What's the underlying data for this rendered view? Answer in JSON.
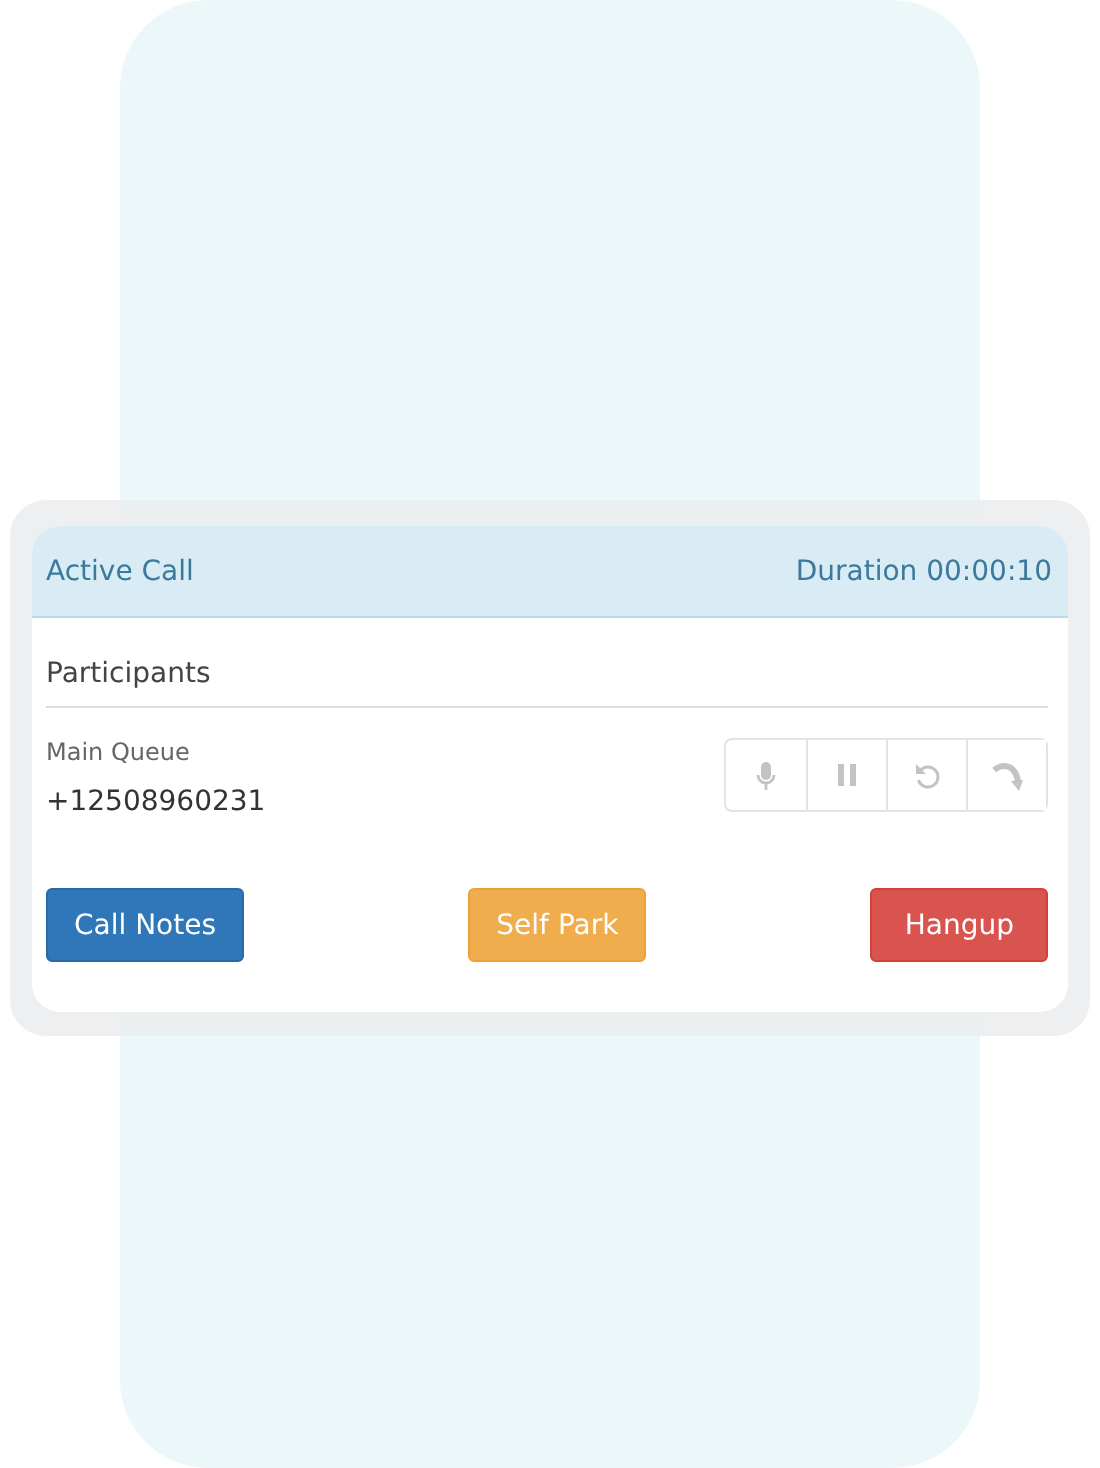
{
  "header": {
    "title": "Active Call",
    "duration": "Duration 00:00:10"
  },
  "participants": {
    "heading": "Participants",
    "items": [
      {
        "name": "Main Queue",
        "number": "+12508960231"
      }
    ]
  },
  "actions": [
    {
      "label": "Call Notes",
      "kind": "primary"
    },
    {
      "label": "Self Park",
      "kind": "warning"
    },
    {
      "label": "Hangup",
      "kind": "danger"
    }
  ]
}
